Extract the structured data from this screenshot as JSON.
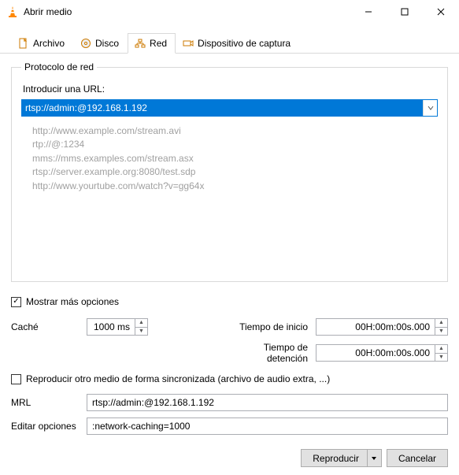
{
  "window": {
    "title": "Abrir medio"
  },
  "tabs": {
    "file": "Archivo",
    "disc": "Disco",
    "network": "Red",
    "capture": "Dispositivo de captura"
  },
  "protocol": {
    "legend": "Protocolo de red",
    "url_label": "Introducir una URL:",
    "url_value": "rtsp://admin:@192.168.1.192",
    "examples": [
      "http://www.example.com/stream.avi",
      "rtp://@:1234",
      "mms://mms.examples.com/stream.asx",
      "rtsp://server.example.org:8080/test.sdp",
      "http://www.yourtube.com/watch?v=gg64x"
    ]
  },
  "more": {
    "label": "Mostrar más opciones",
    "checked": true
  },
  "cache": {
    "label": "Caché",
    "value": "1000 ms"
  },
  "start": {
    "label": "Tiempo de inicio",
    "value": "00H:00m:00s.000"
  },
  "stop": {
    "label": "Tiempo de detención",
    "value": "00H:00m:00s.000"
  },
  "sync": {
    "label": "Reproducir otro medio de forma sincronizada (archivo de audio extra, ...)",
    "checked": false
  },
  "mrl": {
    "label": "MRL",
    "value": "rtsp://admin:@192.168.1.192"
  },
  "edit": {
    "label": "Editar opciones",
    "value": ":network-caching=1000"
  },
  "footer": {
    "play": "Reproducir",
    "cancel": "Cancelar"
  }
}
